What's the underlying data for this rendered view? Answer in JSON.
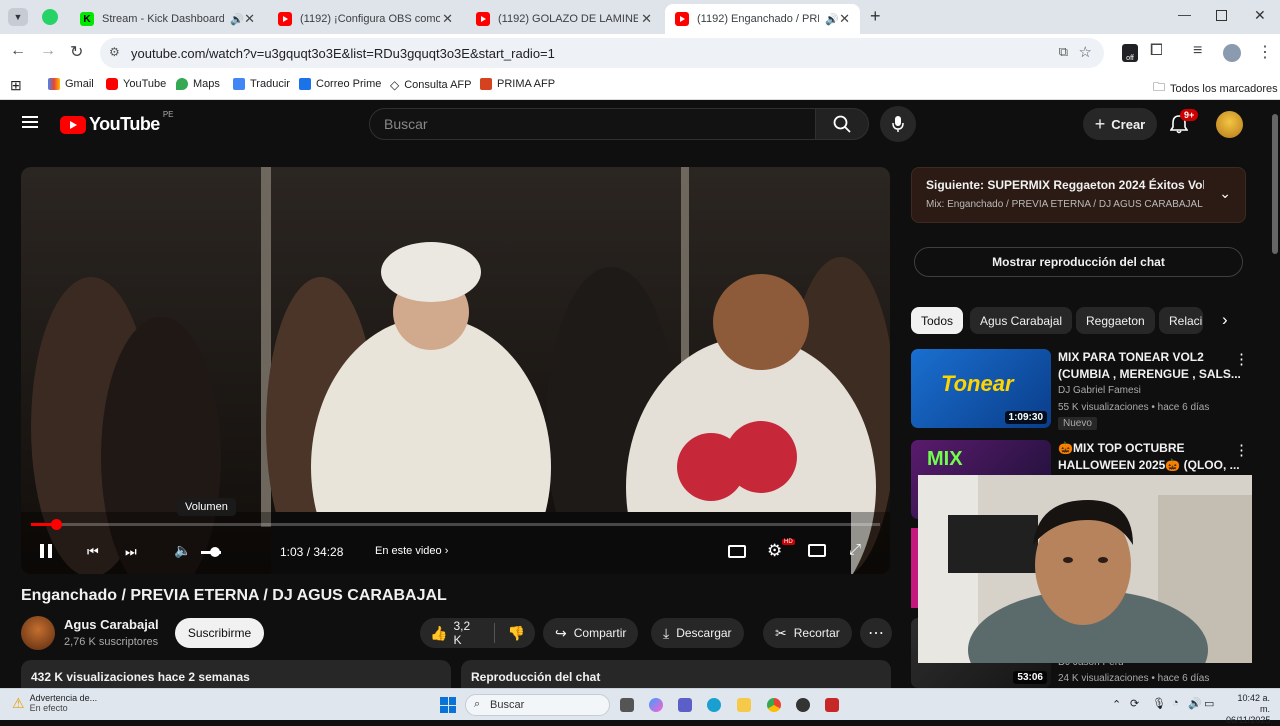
{
  "browser": {
    "tabs": [
      {
        "title": "Stream - Kick Dashboard",
        "favicon": "kick-icon"
      },
      {
        "title": "(1192) ¡Configura OBS como un",
        "favicon": "youtube-icon"
      },
      {
        "title": "(1192) GOLAZO DE LAMINE, BL",
        "favicon": "youtube-icon"
      },
      {
        "title": "(1192) Enganchado / PREVI",
        "favicon": "youtube-icon"
      }
    ],
    "url": "youtube.com/watch?v=u3gquqt3o3E&list=RDu3gquqt3o3E&start_radio=1",
    "bookmarks": [
      "Gmail",
      "YouTube",
      "Maps",
      "Traducir",
      "Correo Prime",
      "Consulta AFP",
      "PRIMA AFP"
    ],
    "all_bookmarks": "Todos los marcadores"
  },
  "youtube": {
    "logo": "YouTube",
    "country": "PE",
    "search_placeholder": "Buscar",
    "create": "Crear",
    "notifications": "9+",
    "player": {
      "volume_tooltip": "Volumen",
      "time": "1:03 / 34:28",
      "in_video": "En este video",
      "progress_fraction": 0.03
    },
    "video_title": "Enganchado / PREVIA ETERNA / DJ AGUS CARABAJAL",
    "channel_name": "Agus Carabajal",
    "subscribers": "2,76 K suscriptores",
    "subscribe": "Suscribirme",
    "likes": "3,2 K",
    "share": "Compartir",
    "download": "Descargar",
    "clip": "Recortar",
    "views_date": "432 K visualizaciones  hace 2 semanas",
    "chat_replay_box": "Reproducción del chat",
    "next": {
      "title": "Siguiente: SUPERMIX Reggaeton 2024 Éxitos Vol 1...",
      "subtitle": "Mix: Enganchado / PREVIA ETERNA / DJ AGUS CARABAJAL"
    },
    "show_chat": "Mostrar reproducción del chat",
    "chips": [
      "Todos",
      "Agus Carabajal",
      "Reggaeton",
      "Relaci"
    ],
    "recommendations": [
      {
        "title_line1": "MIX PARA TONEAR VOL2",
        "title_line2": "(CUMBIA , MERENGUE , SALS...",
        "channel": "DJ Gabriel Famesi",
        "meta": "55 K visualizaciones • hace 6 días",
        "badge": "Nuevo",
        "duration": "1:09:30",
        "thumb_text": "Tonear"
      },
      {
        "title_line1": "🎃MIX TOP OCTUBRE",
        "title_line2": "HALLOWEEN 2025🎃 (QLOO, ...",
        "thumb_text": "MIX"
      },
      {
        "channel": "DJ Jason Perú",
        "meta": "24 K visualizaciones • hace 6 días",
        "duration": "53:06"
      }
    ]
  },
  "taskbar": {
    "notice_title": "Advertencia de...",
    "notice_sub": "En efecto",
    "search": "Buscar",
    "time": "10:42 a. m.",
    "date": "06/11/2025"
  }
}
